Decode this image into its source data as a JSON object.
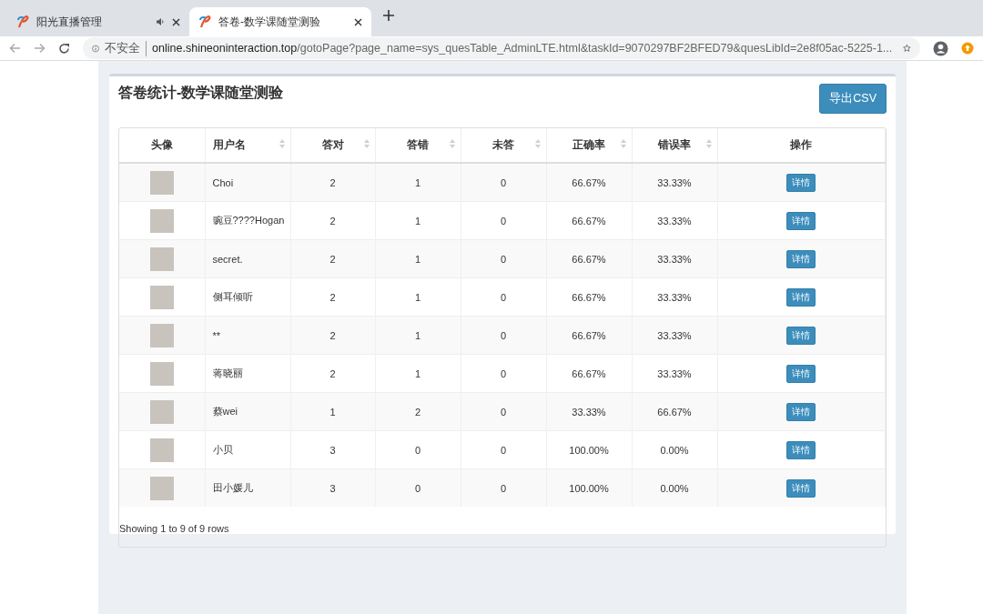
{
  "browser": {
    "tabs": [
      {
        "title": "阳光直播管理",
        "selected": false,
        "audio": true
      },
      {
        "title": "答卷-数学课随堂测验",
        "selected": true,
        "audio": false
      }
    ],
    "address": {
      "security": "不安全",
      "host": "online.shineoninteraction.top",
      "path": "/gotoPage?page_name=sys_quesTable_AdminLTE.html&taskId=9070297BF2BFED79&quesLibId=2e8f05ac-5225-1..."
    }
  },
  "page": {
    "title": "答卷统计-数学课随堂测验",
    "export_button": "导出CSV",
    "table": {
      "columns": [
        {
          "label": "头像",
          "sortable": false
        },
        {
          "label": "用户名",
          "sortable": true
        },
        {
          "label": "答对",
          "sortable": true
        },
        {
          "label": "答错",
          "sortable": true
        },
        {
          "label": "未答",
          "sortable": true
        },
        {
          "label": "正确率",
          "sortable": true
        },
        {
          "label": "错误率",
          "sortable": true
        },
        {
          "label": "操作",
          "sortable": false
        }
      ],
      "rows": [
        {
          "username": "Choi",
          "correct": "2",
          "wrong": "1",
          "unanswered": "0",
          "accuracy": "66.67%",
          "error_rate": "33.33%",
          "action": "详情"
        },
        {
          "username": "豌豆????Hogan",
          "correct": "2",
          "wrong": "1",
          "unanswered": "0",
          "accuracy": "66.67%",
          "error_rate": "33.33%",
          "action": "详情"
        },
        {
          "username": "secret.",
          "correct": "2",
          "wrong": "1",
          "unanswered": "0",
          "accuracy": "66.67%",
          "error_rate": "33.33%",
          "action": "详情"
        },
        {
          "username": "侧耳倾听",
          "correct": "2",
          "wrong": "1",
          "unanswered": "0",
          "accuracy": "66.67%",
          "error_rate": "33.33%",
          "action": "详情"
        },
        {
          "username": "**",
          "correct": "2",
          "wrong": "1",
          "unanswered": "0",
          "accuracy": "66.67%",
          "error_rate": "33.33%",
          "action": "详情"
        },
        {
          "username": "蒋晓丽",
          "correct": "2",
          "wrong": "1",
          "unanswered": "0",
          "accuracy": "66.67%",
          "error_rate": "33.33%",
          "action": "详情"
        },
        {
          "username": "蔡wei",
          "correct": "1",
          "wrong": "2",
          "unanswered": "0",
          "accuracy": "33.33%",
          "error_rate": "66.67%",
          "action": "详情"
        },
        {
          "username": "小贝",
          "correct": "3",
          "wrong": "0",
          "unanswered": "0",
          "accuracy": "100.00%",
          "error_rate": "0.00%",
          "action": "详情"
        },
        {
          "username": "田小媛儿",
          "correct": "3",
          "wrong": "0",
          "unanswered": "0",
          "accuracy": "100.00%",
          "error_rate": "0.00%",
          "action": "详情"
        }
      ],
      "footer": "Showing 1 to 9 of 9 rows"
    }
  }
}
